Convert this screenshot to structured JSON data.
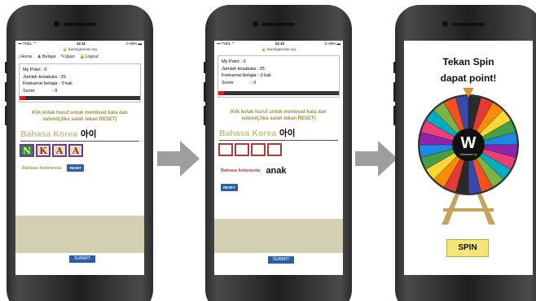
{
  "screen1": {
    "status": {
      "carrier": "TSEL",
      "time": "12.11",
      "battery": "69%"
    },
    "url": "learningkorean.org",
    "nav": [
      {
        "label": "Home"
      },
      {
        "label": "Belajar"
      },
      {
        "label": "Ujian"
      },
      {
        "label": "Logout"
      }
    ],
    "stats": [
      {
        "label": "My Point",
        "value": ": 0"
      },
      {
        "label": "Jumlah kosakata :",
        "value": "25"
      },
      {
        "label": "Frekuensi belajar :",
        "value": "0 kali"
      },
      {
        "label": "Score",
        "value": ":  0"
      }
    ],
    "progress_fraction": 0.05,
    "instruction": "Klik kotak huruf untuk membuat kata dan submit(Jika salah tekan RESET)",
    "word_lang": "Bahasa Korea",
    "word_kr": "아이",
    "tiles": [
      "N",
      "K",
      "A",
      "A"
    ],
    "indo_label": "Bahasa Indonesia:",
    "reset_label": "RESET",
    "submit_label": "SUBMIT"
  },
  "screen2": {
    "status": {
      "carrier": "TSEL",
      "time": "12.12",
      "battery": "69%"
    },
    "url": "learningkorean.org",
    "stats": [
      {
        "label": "My Point :",
        "value": "0"
      },
      {
        "label": "Jumlah kosakata :",
        "value": "25"
      },
      {
        "label": "Frekuensi belajar :",
        "value": "0 kali"
      },
      {
        "label": "Score",
        "value": ":    0"
      }
    ],
    "progress_fraction": 0.05,
    "instruction": "Klik kotak huruf untuk membuat kata dan submit(Jika salah tekan RESET)",
    "word_lang": "Bahasa Korea",
    "word_kr": "아이",
    "tiles": [
      "",
      "",
      "",
      ""
    ],
    "indo_label": "Bahasa Indonesia:",
    "indo_answer": "anak",
    "reset_label": "RESET",
    "submit_label": "SUBMIT"
  },
  "screen3": {
    "title_line1": "Tekan Spin",
    "title_line2": "dapat point!",
    "wheel_logo": "W",
    "wheel_caption": "Winwheel.js",
    "spin_label": "SPIN",
    "wheel_colors": [
      "#2a2a2a",
      "#e53935",
      "#fb8c00",
      "#fdd835",
      "#43a047",
      "#1e88e5",
      "#8e24aa",
      "#ec407a",
      "#00acc1",
      "#7cb342",
      "#f4511e",
      "#3949ab"
    ]
  },
  "colors": {
    "accent_blue": "#2a5fa5",
    "tan": "#d3d0b4",
    "olive_text": "#9a8f44",
    "arrow": "#9e9e9e"
  }
}
